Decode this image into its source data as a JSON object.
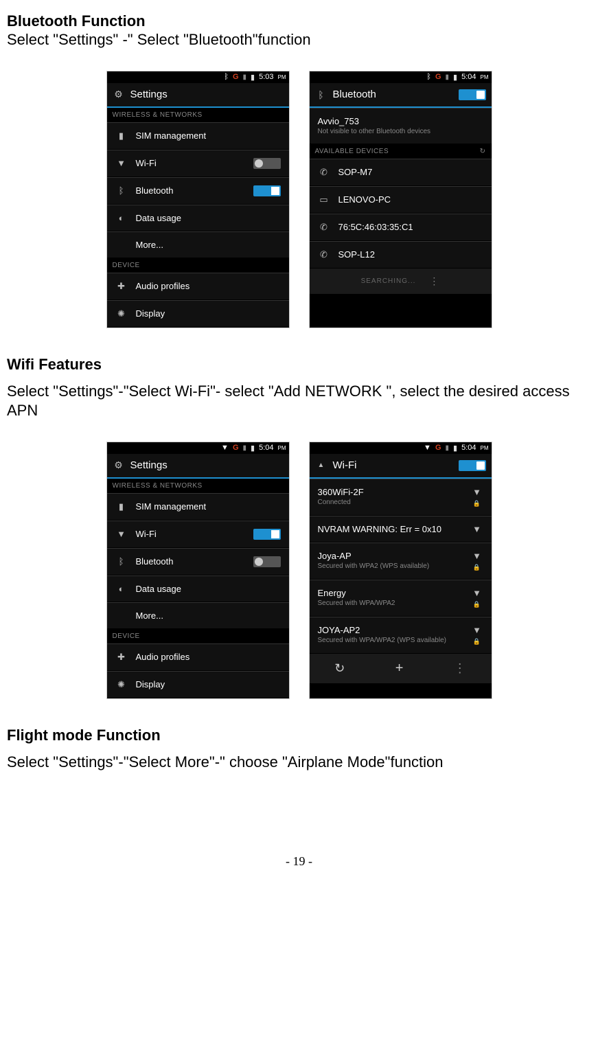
{
  "page_number": "- 19 -",
  "sec1": {
    "title": "Bluetooth Function",
    "body": "Select \"Settings\" -\" Select \"Bluetooth\"function"
  },
  "sec2": {
    "title": "Wifi Features",
    "body": "Select \"Settings\"-\"Select Wi-Fi\"- select \"Add NETWORK \", select the desired access APN"
  },
  "sec3": {
    "title": "Flight mode Function",
    "body": "Select \"Settings\"-\"Select More\"-\" choose \"Airplane Mode\"function"
  },
  "status": {
    "g": "G",
    "time1": "5:03",
    "time2": "5:04",
    "pm": "PM"
  },
  "settings": {
    "title": "Settings",
    "group_wireless": "WIRELESS & NETWORKS",
    "group_device": "DEVICE",
    "sim": "SIM management",
    "wifi": "Wi-Fi",
    "bluetooth": "Bluetooth",
    "data": "Data usage",
    "more": "More...",
    "audio": "Audio profiles",
    "display": "Display"
  },
  "bt_screen": {
    "title": "Bluetooth",
    "device_name": "Avvio_753",
    "device_sub": "Not visible to other Bluetooth devices",
    "group_avail": "AVAILABLE DEVICES",
    "d1": "SOP-M7",
    "d2": "LENOVO-PC",
    "d3": "76:5C:46:03:35:C1",
    "d4": "SOP-L12",
    "searching": "SEARCHING..."
  },
  "wifi_screen": {
    "title": "Wi-Fi",
    "n1": "360WiFi-2F",
    "n1s": "Connected",
    "n2": "NVRAM WARNING: Err = 0x10",
    "n3": "Joya-AP",
    "n3s": "Secured with WPA2 (WPS available)",
    "n4": "Energy",
    "n4s": "Secured with WPA/WPA2",
    "n5": "JOYA-AP2",
    "n5s": "Secured with WPA/WPA2 (WPS available)"
  }
}
